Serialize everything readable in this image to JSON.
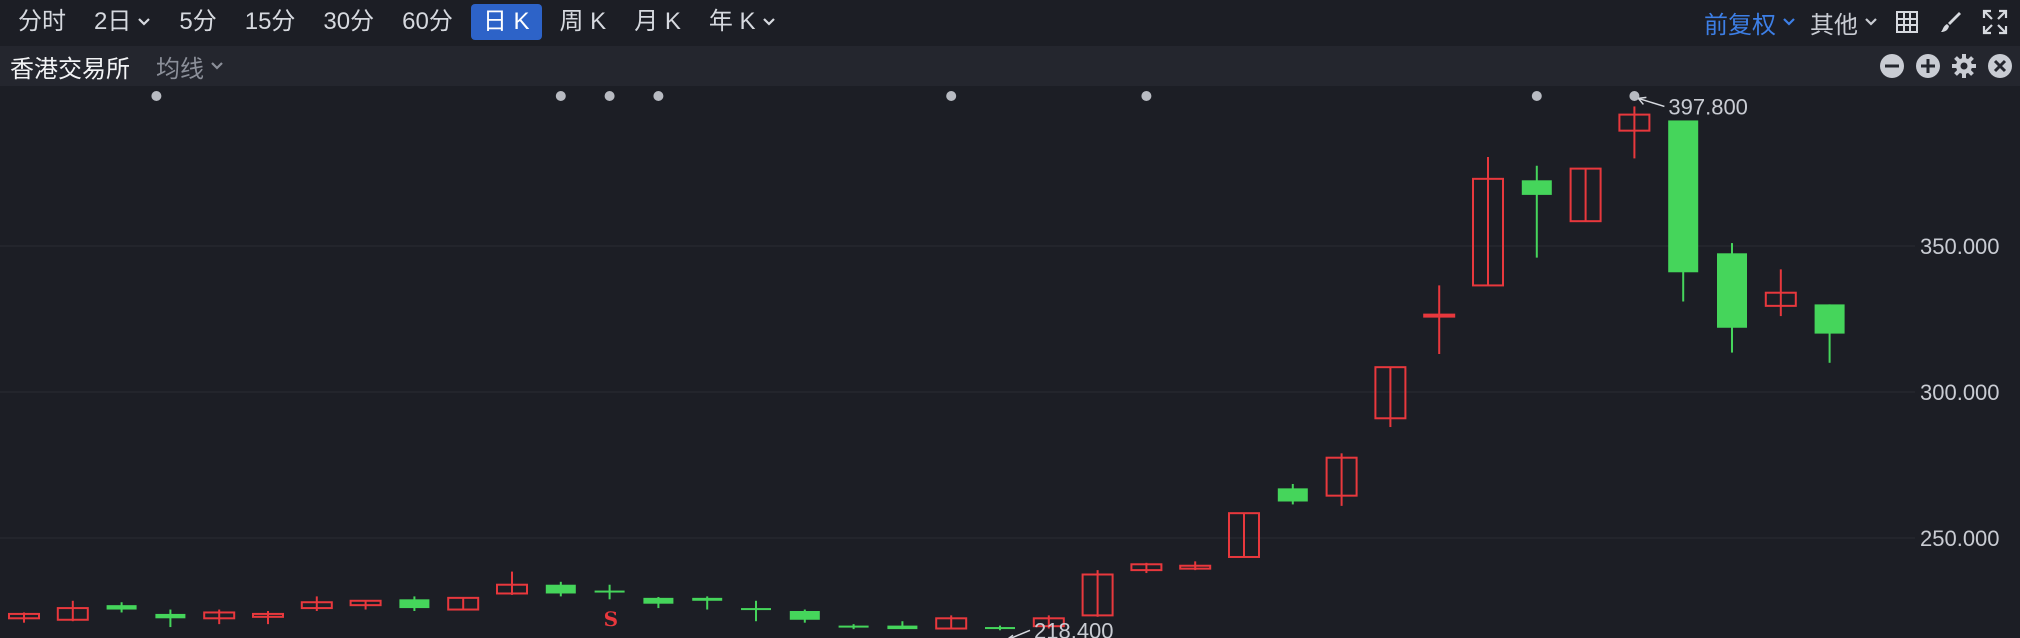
{
  "toolbar": {
    "tabs": [
      {
        "label": "分时",
        "has_dropdown": false,
        "active": false
      },
      {
        "label": "2日",
        "has_dropdown": true,
        "active": false
      },
      {
        "label": "5分",
        "has_dropdown": false,
        "active": false
      },
      {
        "label": "15分",
        "has_dropdown": false,
        "active": false
      },
      {
        "label": "30分",
        "has_dropdown": false,
        "active": false
      },
      {
        "label": "60分",
        "has_dropdown": false,
        "active": false
      },
      {
        "label": "日 K",
        "has_dropdown": false,
        "active": true
      },
      {
        "label": "周 K",
        "has_dropdown": false,
        "active": false
      },
      {
        "label": "月 K",
        "has_dropdown": false,
        "active": false
      },
      {
        "label": "年 K",
        "has_dropdown": true,
        "active": false
      }
    ],
    "adjust_label": "前复权",
    "other_label": "其他",
    "icons": [
      "grid-icon",
      "brush-icon",
      "fullscreen-icon"
    ]
  },
  "subbar": {
    "exchange": "香港交易所",
    "indicator": "均线",
    "icons": [
      "minus-icon",
      "plus-icon",
      "settings-icon",
      "close-icon"
    ]
  },
  "colors": {
    "up": "#e8383d",
    "down": "#45d55b",
    "accent": "#2d63c8",
    "background": "#1c1e25"
  },
  "chart_data": {
    "type": "candlestick",
    "y_ticks": [
      "350.000",
      "300.000",
      "250.000"
    ],
    "y_tick_values": [
      350,
      300,
      250
    ],
    "ylim": [
      212,
      410
    ],
    "grid": true,
    "max_label": "397.800",
    "min_label": "218.400",
    "signal_marker": "S",
    "candles": [
      {
        "o": 222.5,
        "h": 224.5,
        "l": 221.0,
        "c": 224.0,
        "up": true
      },
      {
        "o": 222.0,
        "h": 228.5,
        "l": 221.5,
        "c": 226.0,
        "up": true
      },
      {
        "o": 227.0,
        "h": 228.0,
        "l": 224.5,
        "c": 225.5,
        "up": false
      },
      {
        "o": 224.0,
        "h": 225.5,
        "l": 219.5,
        "c": 222.5,
        "up": false
      },
      {
        "o": 222.5,
        "h": 225.5,
        "l": 220.5,
        "c": 224.5,
        "up": true
      },
      {
        "o": 223.0,
        "h": 225.0,
        "l": 220.5,
        "c": 224.0,
        "up": true
      },
      {
        "o": 226.0,
        "h": 230.0,
        "l": 225.0,
        "c": 228.0,
        "up": true
      },
      {
        "o": 227.0,
        "h": 228.5,
        "l": 225.5,
        "c": 228.5,
        "up": true
      },
      {
        "o": 229.0,
        "h": 230.0,
        "l": 225.0,
        "c": 226.0,
        "up": false
      },
      {
        "o": 225.5,
        "h": 229.5,
        "l": 225.5,
        "c": 229.5,
        "up": true
      },
      {
        "o": 231.0,
        "h": 238.5,
        "l": 230.5,
        "c": 234.0,
        "up": true
      },
      {
        "o": 234.0,
        "h": 235.0,
        "l": 230.0,
        "c": 231.0,
        "up": false
      },
      {
        "o": 232.0,
        "h": 234.0,
        "l": 229.0,
        "c": 232.0,
        "up": false
      },
      {
        "o": 229.5,
        "h": 229.8,
        "l": 226.0,
        "c": 227.5,
        "up": false
      },
      {
        "o": 229.5,
        "h": 230.0,
        "l": 225.5,
        "c": 228.5,
        "up": false
      },
      {
        "o": 226.0,
        "h": 228.5,
        "l": 221.5,
        "c": 226.0,
        "up": false
      },
      {
        "o": 225.0,
        "h": 225.5,
        "l": 221.0,
        "c": 222.0,
        "up": false
      },
      {
        "o": 220.0,
        "h": 220.5,
        "l": 218.8,
        "c": 219.5,
        "up": false
      },
      {
        "o": 220.0,
        "h": 221.5,
        "l": 218.8,
        "c": 218.8,
        "up": false
      },
      {
        "o": 219.0,
        "h": 223.5,
        "l": 218.8,
        "c": 222.5,
        "up": true
      },
      {
        "o": 219.5,
        "h": 220.0,
        "l": 218.4,
        "c": 219.5,
        "up": false
      },
      {
        "o": 219.8,
        "h": 223.5,
        "l": 219.0,
        "c": 222.5,
        "up": true
      },
      {
        "o": 223.5,
        "h": 239.0,
        "l": 223.0,
        "c": 237.5,
        "up": true
      },
      {
        "o": 239.0,
        "h": 241.5,
        "l": 238.0,
        "c": 241.0,
        "up": true
      },
      {
        "o": 239.5,
        "h": 242.0,
        "l": 239.0,
        "c": 240.5,
        "up": true
      },
      {
        "o": 243.5,
        "h": 258.5,
        "l": 243.5,
        "c": 258.5,
        "up": true
      },
      {
        "o": 267.0,
        "h": 268.5,
        "l": 261.5,
        "c": 262.5,
        "up": false
      },
      {
        "o": 264.5,
        "h": 279.0,
        "l": 261.0,
        "c": 277.5,
        "up": true
      },
      {
        "o": 291.0,
        "h": 308.5,
        "l": 288.0,
        "c": 308.5,
        "up": true
      },
      {
        "o": 326.5,
        "h": 336.5,
        "l": 313.0,
        "c": 326.5,
        "up": true
      },
      {
        "o": 336.5,
        "h": 380.5,
        "l": 336.5,
        "c": 373.0,
        "up": true
      },
      {
        "o": 372.5,
        "h": 377.5,
        "l": 346.0,
        "c": 367.5,
        "up": false
      },
      {
        "o": 358.5,
        "h": 376.5,
        "l": 358.5,
        "c": 376.5,
        "up": true
      },
      {
        "o": 389.5,
        "h": 397.8,
        "l": 380.0,
        "c": 395.0,
        "up": true
      },
      {
        "o": 393.0,
        "h": 393.0,
        "l": 331.0,
        "c": 341.0,
        "up": false
      },
      {
        "o": 347.5,
        "h": 351.0,
        "l": 313.5,
        "c": 322.0,
        "up": false
      },
      {
        "o": 329.5,
        "h": 342.0,
        "l": 326.0,
        "c": 334.0,
        "up": true
      },
      {
        "o": 330.0,
        "h": 330.0,
        "l": 310.0,
        "c": 320.0,
        "up": false
      }
    ],
    "event_dot_candles": [
      3,
      11,
      12,
      13,
      19,
      23,
      31,
      33
    ],
    "signal_candle": 12
  }
}
